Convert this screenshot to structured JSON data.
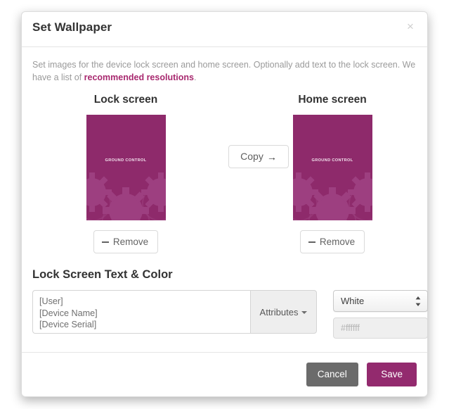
{
  "modal": {
    "title": "Set Wallpaper",
    "close_icon": "close-icon",
    "intro_text_before": "Set images for the device lock screen and home screen. Optionally add text to the lock screen. We have a list of ",
    "intro_link": "recommended resolutions",
    "intro_text_after": "."
  },
  "panes": {
    "lock": {
      "title": "Lock screen",
      "wallpaper_label": "GROUND CONTROL",
      "wallpaper_bg": "#8e2a6b",
      "wallpaper_gear_color": "#9d3f80",
      "remove_label": "Remove",
      "remove_icon": "minus-icon"
    },
    "home": {
      "title": "Home screen",
      "wallpaper_label": "GROUND CONTROL",
      "wallpaper_bg": "#8e2a6b",
      "wallpaper_gear_color": "#9d3f80",
      "remove_label": "Remove",
      "remove_icon": "minus-icon"
    },
    "copy": {
      "label": "Copy",
      "icon": "arrow-right-icon",
      "glyph": "→"
    }
  },
  "lock_text_section": {
    "title": "Lock Screen Text & Color",
    "textarea_value": "[User]\n[Device Name]\n[Device Serial]",
    "textarea_placeholder": "",
    "attributes_label": "Attributes",
    "attributes_icon": "caret-down-icon",
    "color_selected": "White",
    "color_select_icon": "updown-arrows-icon",
    "hex_value": "",
    "hex_placeholder": "#ffffff"
  },
  "footer": {
    "cancel_label": "Cancel",
    "save_label": "Save",
    "cancel_color": "#6b6b6b",
    "save_color": "#932a6e"
  },
  "colors": {
    "accent": "#a8296f",
    "title_text": "#333333",
    "muted_text": "#9a9a9a"
  }
}
